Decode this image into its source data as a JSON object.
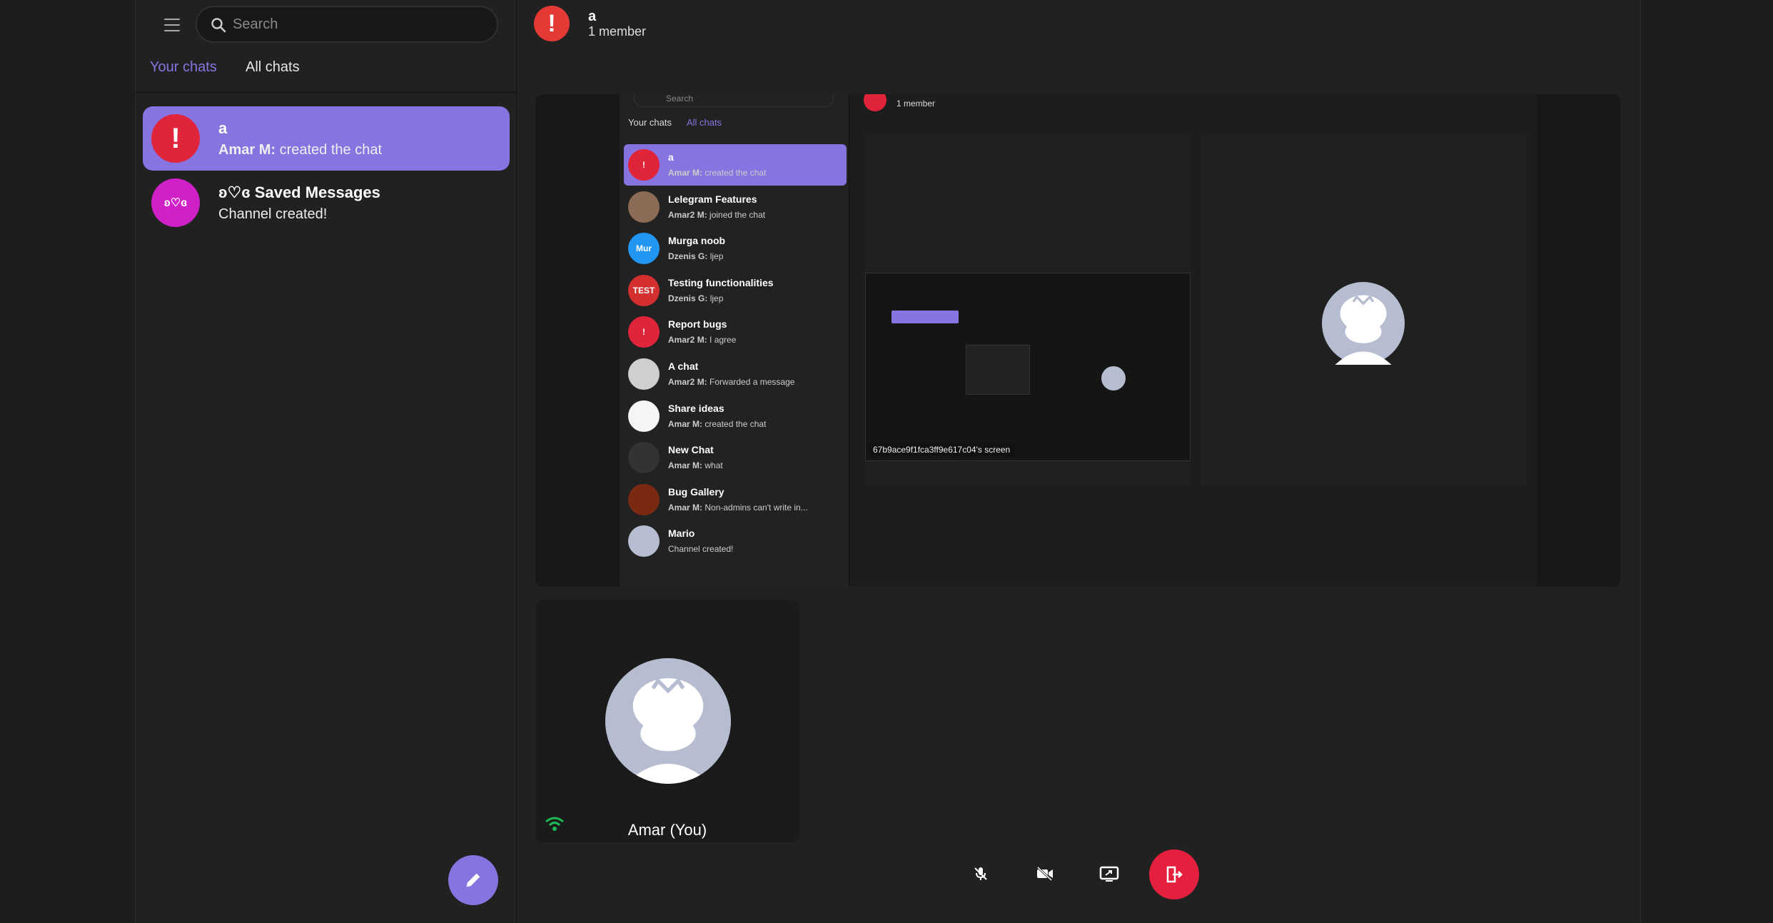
{
  "sidebar": {
    "search_placeholder": "Search",
    "tabs": [
      {
        "label": "Your chats"
      },
      {
        "label": "All chats"
      }
    ],
    "chats": [
      {
        "avatar_text": "!",
        "name": "a",
        "sender": "Amar M:",
        "message": "created the chat",
        "color": "#e0243a"
      },
      {
        "avatar_text": "ʚ♡ɞ",
        "name": "ʚ♡ɞ Saved Messages",
        "sender": "",
        "message": "Channel created!",
        "color": "#d020c8"
      }
    ]
  },
  "header": {
    "avatar_text": "!",
    "title": "a",
    "subtitle": "1 member"
  },
  "shared_screen": {
    "mini_header_sub": "1 member",
    "mini_search": "Search",
    "mini_tabs": [
      {
        "label": "Your chats"
      },
      {
        "label": "All chats"
      }
    ],
    "chats": [
      {
        "avatar": "!",
        "name": "a",
        "sender": "Amar M:",
        "message": "created the chat",
        "color": "#e0243a"
      },
      {
        "avatar": "",
        "name": "Lelegram Features",
        "sender": "Amar2 M:",
        "message": "joined the chat",
        "color": "#8b6b55"
      },
      {
        "avatar": "Mur",
        "name": "Murga noob",
        "sender": "Dzenis G:",
        "message": "ljep",
        "color": "#2196f3"
      },
      {
        "avatar": "TEST",
        "name": "Testing functionalities",
        "sender": "Dzenis G:",
        "message": "ljep",
        "color": "#d32f2f"
      },
      {
        "avatar": "!",
        "name": "Report bugs",
        "sender": "Amar2 M:",
        "message": "I agree",
        "color": "#e0243a"
      },
      {
        "avatar": "",
        "name": "A chat",
        "sender": "Amar2 M:",
        "message": "Forwarded a message",
        "color": "#cfcfcf"
      },
      {
        "avatar": "",
        "name": "Share ideas",
        "sender": "Amar M:",
        "message": "created the chat",
        "color": "#f5f5f5"
      },
      {
        "avatar": "",
        "name": "New Chat",
        "sender": "Amar M:",
        "message": "what",
        "color": "#333"
      },
      {
        "avatar": "",
        "name": "Bug Gallery",
        "sender": "Amar M:",
        "message": "Non-admins can't write in...",
        "color": "#7a2a10"
      },
      {
        "avatar": "",
        "name": "Mario",
        "sender": "",
        "message": "Channel created!",
        "color": "#b6bdd0"
      }
    ],
    "screen_caption": "67b9ace9f1fca3ff9e617c04's screen"
  },
  "self_tile": {
    "name": "Amar (You)"
  },
  "controls": [
    {
      "icon": "mic-off-icon"
    },
    {
      "icon": "video-off-icon"
    },
    {
      "icon": "screen-share-icon"
    },
    {
      "icon": "leave-call-icon"
    }
  ],
  "colors": {
    "accent": "#8774e1",
    "danger": "#e5203e",
    "bg": "#212121"
  }
}
